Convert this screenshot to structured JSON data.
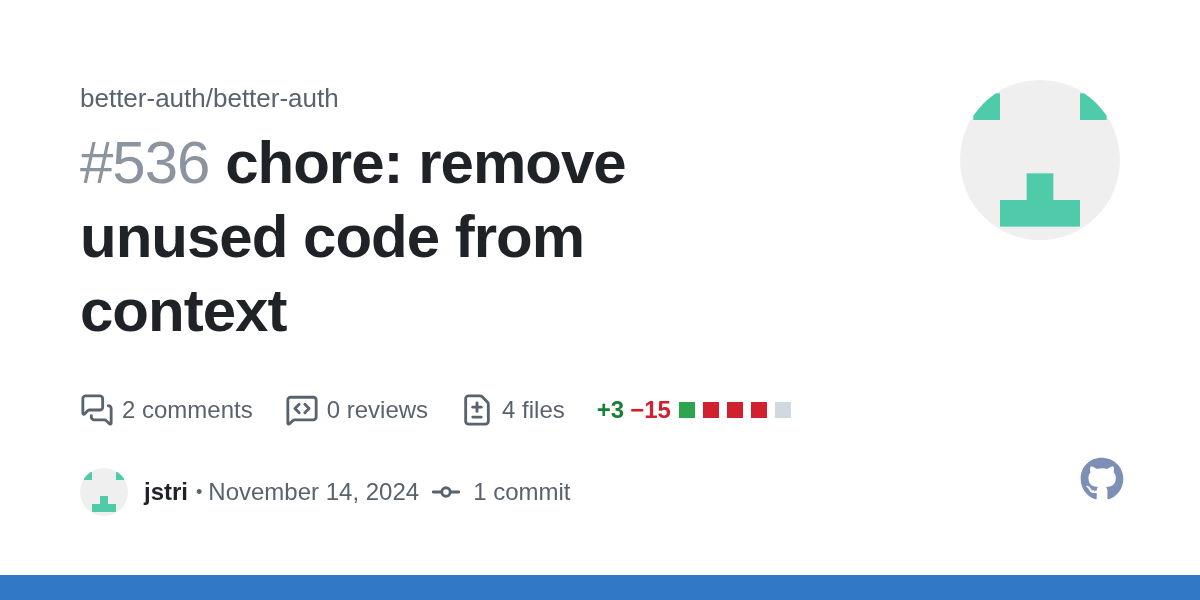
{
  "repo": "better-auth/better-auth",
  "number": "#536",
  "title": "chore: remove unused code from context",
  "stats": [
    {
      "kind": "comments",
      "text": "2 comments"
    },
    {
      "kind": "reviews",
      "text": "0 reviews"
    },
    {
      "kind": "files",
      "text": "4 files"
    }
  ],
  "diff": {
    "additions": "+3",
    "deletions": "−15",
    "blocks": [
      {
        "color": "#2da44e"
      },
      {
        "color": "#cf222e"
      },
      {
        "color": "#cf222e"
      },
      {
        "color": "#cf222e"
      },
      {
        "color": "#d1d9e0"
      }
    ]
  },
  "author": {
    "name": "jstri",
    "separator": "•",
    "date": "November 14, 2024"
  },
  "commits": "1 commit"
}
